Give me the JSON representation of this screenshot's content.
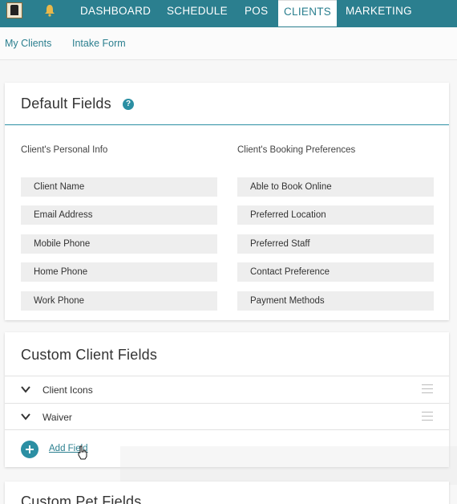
{
  "nav": {
    "items": [
      "DASHBOARD",
      "SCHEDULE",
      "POS",
      "CLIENTS",
      "MARKETING"
    ],
    "active": "CLIENTS",
    "logo_icon": "business-logo-icon",
    "bell_icon": "bell-icon"
  },
  "subnav": {
    "links": [
      "My Clients",
      "Intake Form"
    ]
  },
  "default_fields": {
    "title": "Default Fields",
    "help_icon": "?",
    "personal_header": "Client's Personal Info",
    "booking_header": "Client's Booking Preferences",
    "personal": [
      "Client Name",
      "Email Address",
      "Mobile Phone",
      "Home Phone",
      "Work Phone"
    ],
    "booking": [
      "Able to Book Online",
      "Preferred Location",
      "Preferred Staff",
      "Contact Preference",
      "Payment Methods"
    ]
  },
  "custom_client_fields": {
    "title": "Custom Client Fields",
    "rows": [
      "Client Icons",
      "Waiver"
    ],
    "add_label": "Add Field"
  },
  "custom_pet_fields": {
    "title": "Custom Pet Fields"
  },
  "colors": {
    "accent": "#2b7f8f",
    "button": "#2b8fa3"
  }
}
